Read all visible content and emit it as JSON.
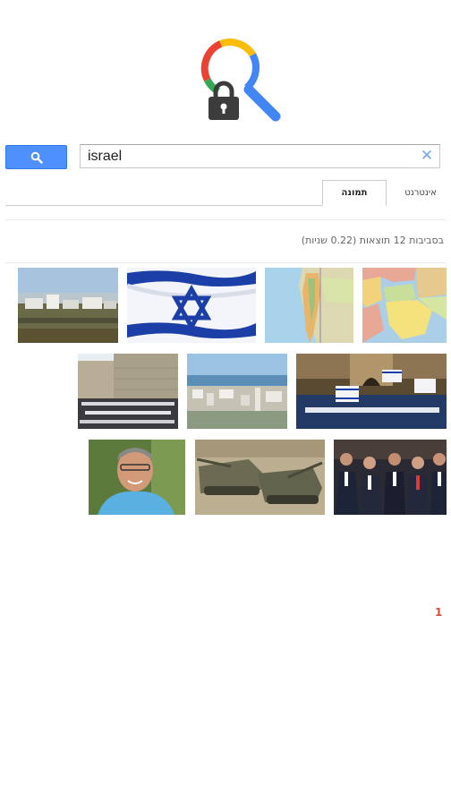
{
  "search": {
    "query": "israel",
    "button_icon": "search-icon",
    "clear_label": "✕"
  },
  "tabs": [
    {
      "label": "תמונה",
      "active": true
    },
    {
      "label": "אינטרנט",
      "active": false
    }
  ],
  "results": {
    "info": "בסביבות 12 תוצאות (0.22 שניות)"
  },
  "images": [
    {
      "subject": "village landscape"
    },
    {
      "subject": "israeli flag"
    },
    {
      "subject": "map of israel"
    },
    {
      "subject": "middle east map"
    },
    {
      "subject": "western wall crowd"
    },
    {
      "subject": "haifa city view"
    },
    {
      "subject": "flag march"
    },
    {
      "subject": "smiling man portrait"
    },
    {
      "subject": "tanks"
    },
    {
      "subject": "officials seated"
    }
  ],
  "pagination": {
    "current_page": "1"
  },
  "colors": {
    "accent": "#4d90fe",
    "page_number": "#dd4b39",
    "logo_red": "#ea4335",
    "logo_yellow": "#fbbc05",
    "logo_green": "#34a853",
    "logo_blue": "#4285f4",
    "lock": "#3c3c3c"
  }
}
